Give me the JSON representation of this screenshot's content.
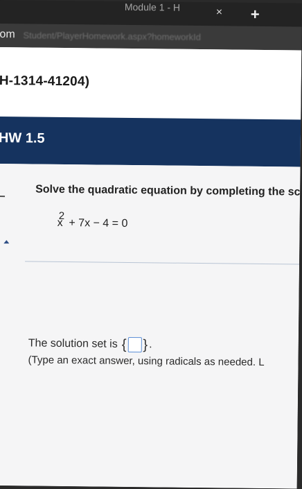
{
  "browser": {
    "tab_title": "Module 1 - H",
    "tab_close": "×",
    "new_tab": "+",
    "url_scheme": "om",
    "url_rest": "Student/PlayerHomework.aspx?homeworkId"
  },
  "header": {
    "course_id": "H-1314-41204)",
    "hw_title": "HW 1.5"
  },
  "question": {
    "prompt": "Solve the quadratic equation by completing the sc",
    "equation_base": "x",
    "equation_exponent": "2",
    "equation_rest": "+ 7x − 4 = 0"
  },
  "answer": {
    "solution_label": "The solution set is",
    "brace_open": "{",
    "brace_close": "}",
    "period": ".",
    "instruction": "(Type an exact answer, using radicals as needed. L"
  },
  "colors": {
    "banner": "#15335f",
    "answer_box_border": "#5b8ed6"
  }
}
